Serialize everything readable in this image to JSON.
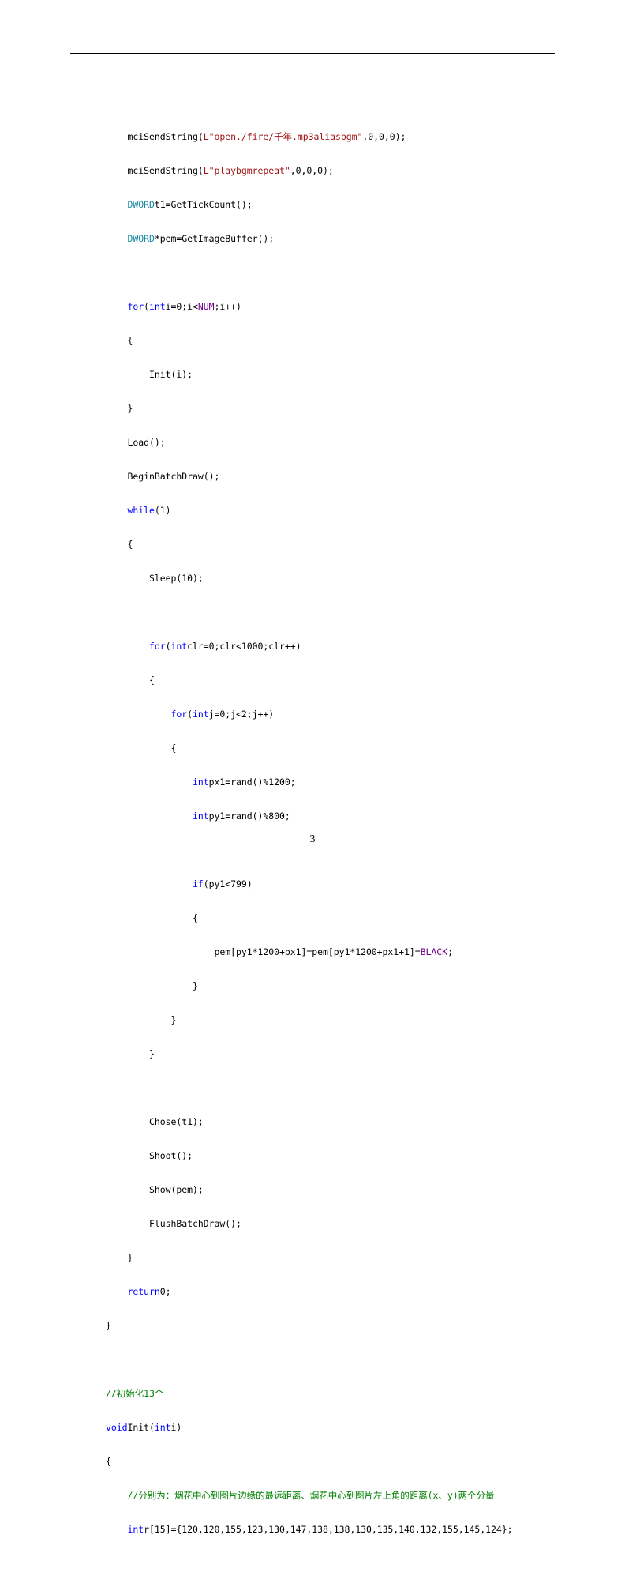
{
  "code": {
    "l1a": "mciSendString(",
    "l1s": "L\"open./fire/千年.mp3aliasbgm\"",
    "l1b": ",0,0,0);",
    "l2a": "mciSendString(",
    "l2s": "L\"playbgmrepeat\"",
    "l2b": ",0,0,0);",
    "l3t": "DWORD",
    "l3b": "t1=GetTickCount();",
    "l4t": "DWORD",
    "l4b": "*pem=GetImageBuffer();",
    "blank1": "",
    "l5k": "for",
    "l5a": "(",
    "l5t": "int",
    "l5b": "i=0;i<",
    "l5c": "NUM",
    "l5d": ";i++)",
    "l6": "{",
    "l7": "    Init(i);",
    "l8": "}",
    "l9": "Load();",
    "l10": "BeginBatchDraw();",
    "l11k": "while",
    "l11b": "(1)",
    "l12": "{",
    "l13": "    Sleep(10);",
    "blank2": "",
    "l14a": "    ",
    "l14k": "for",
    "l14b": "(",
    "l14t": "int",
    "l14c": "clr=0;clr<1000;clr++)",
    "l15": "    {",
    "l16a": "        ",
    "l16k": "for",
    "l16b": "(",
    "l16t": "int",
    "l16c": "j=0;j<2;j++)",
    "l17": "        {",
    "l18a": "            ",
    "l18t": "int",
    "l18b": "px1=rand()%1200;",
    "l19a": "            ",
    "l19t": "int",
    "l19b": "py1=rand()%800;",
    "blank3": "",
    "l20a": "            ",
    "l20k": "if",
    "l20b": "(py1<799)",
    "l21": "            {",
    "l22a": "                pem[py1*1200+px1]=pem[py1*1200+px1+1]=",
    "l22c": "BLACK",
    "l22b": ";",
    "l23": "            }",
    "l24": "        }",
    "l25": "    }",
    "blank4": "",
    "l26": "    Chose(t1);",
    "l27": "    Shoot();",
    "l28": "    Show(pem);",
    "l29": "    FlushBatchDraw();",
    "l30": "}",
    "l31k": "return",
    "l31b": "0;",
    "l32": "}",
    "blank5": "",
    "l33": "//初始化13个",
    "l34t": "void",
    "l34a": "Init(",
    "l34t2": "int",
    "l34b": "i)",
    "l35": "{",
    "l36": "//分别为：烟花中心到图片边缘的最远距离、烟花中心到图片左上角的距离(x、y)两个分量",
    "l37t": "int",
    "l37b": "r[15]={120,120,155,123,130,147,138,138,130,135,140,132,155,145,124};"
  },
  "page_number": "3"
}
